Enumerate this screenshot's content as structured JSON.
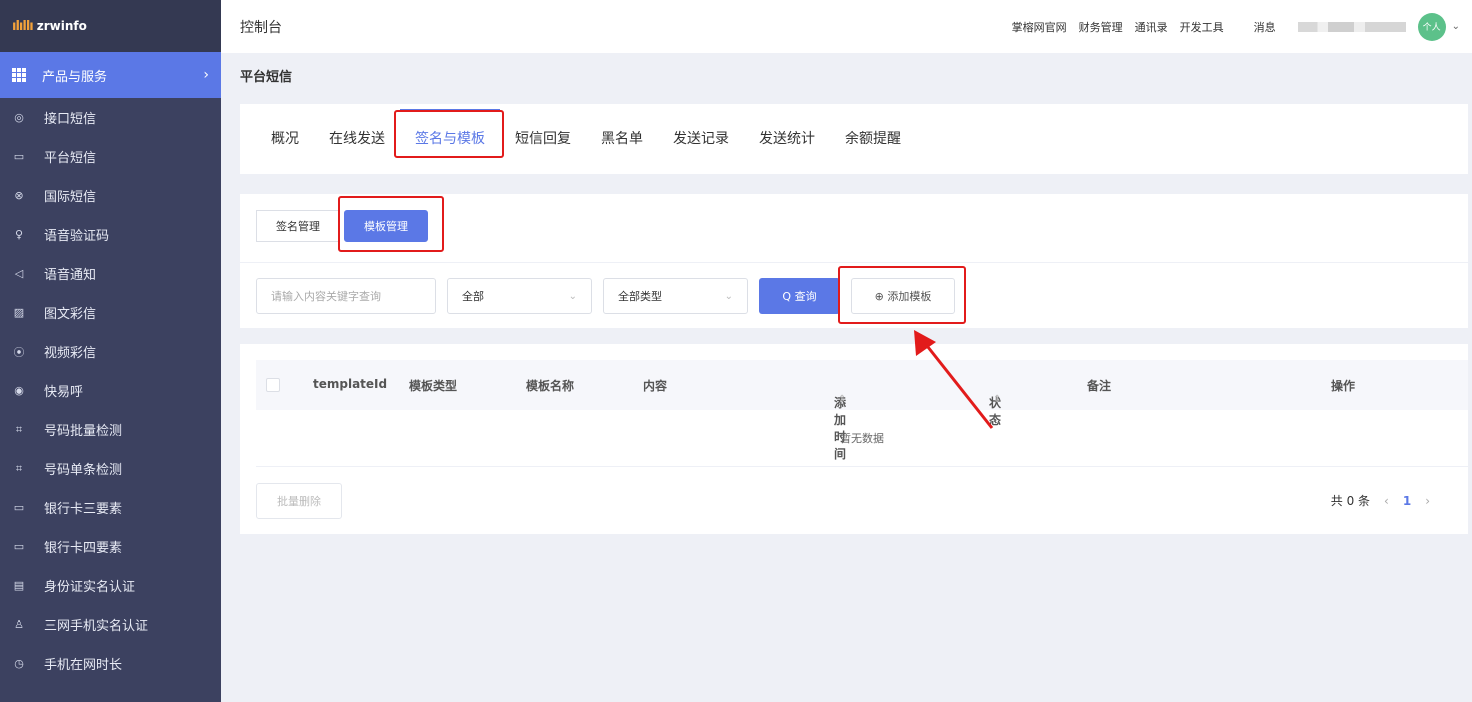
{
  "app": {
    "brand": "zrwinfo",
    "header_title": "控制台",
    "header_links": [
      "掌榕网官网",
      "财务管理",
      "通讯录",
      "开发工具"
    ],
    "messages_label": "消息",
    "avatar_text": "个人"
  },
  "sidebar": {
    "section_label": "产品与服务",
    "items": [
      {
        "label": "接口短信",
        "icon": "chat-icon"
      },
      {
        "label": "平台短信",
        "icon": "message-icon"
      },
      {
        "label": "国际短信",
        "icon": "globe-icon"
      },
      {
        "label": "语音验证码",
        "icon": "microphone-icon"
      },
      {
        "label": "语音通知",
        "icon": "speaker-icon"
      },
      {
        "label": "图文彩信",
        "icon": "image-icon"
      },
      {
        "label": "视频彩信",
        "icon": "play-icon"
      },
      {
        "label": "快易呼",
        "icon": "phone-call-icon"
      },
      {
        "label": "号码批量检测",
        "icon": "scan-icon"
      },
      {
        "label": "号码单条检测",
        "icon": "scan-icon"
      },
      {
        "label": "银行卡三要素",
        "icon": "card-icon"
      },
      {
        "label": "银行卡四要素",
        "icon": "card-icon"
      },
      {
        "label": "身份证实名认证",
        "icon": "id-card-icon"
      },
      {
        "label": "三网手机实名认证",
        "icon": "user-icon"
      },
      {
        "label": "手机在网时长",
        "icon": "clock-icon"
      }
    ]
  },
  "page": {
    "title": "平台短信",
    "tabs": [
      "概况",
      "在线发送",
      "签名与模板",
      "短信回复",
      "黑名单",
      "发送记录",
      "发送统计",
      "余额提醒"
    ],
    "active_tab": 2
  },
  "segment": {
    "signature_label": "签名管理",
    "template_label": "模板管理"
  },
  "filters": {
    "search_placeholder": "请输入内容关键字查询",
    "status_value": "全部",
    "type_value": "全部类型",
    "query_label": "Q 查询",
    "add_label": "⊕ 添加模板"
  },
  "table": {
    "columns": [
      "templateId",
      "模板类型",
      "模板名称",
      "内容",
      "添加时间",
      "状态",
      "备注",
      "操作"
    ],
    "empty_text": "暂无数据",
    "batch_delete_label": "批量删除",
    "total_label": "共 0 条",
    "current_page": "1"
  },
  "colors": {
    "primary": "#5b78e6",
    "sidebar": "#3c4160",
    "annotation": "#e21b1b"
  }
}
